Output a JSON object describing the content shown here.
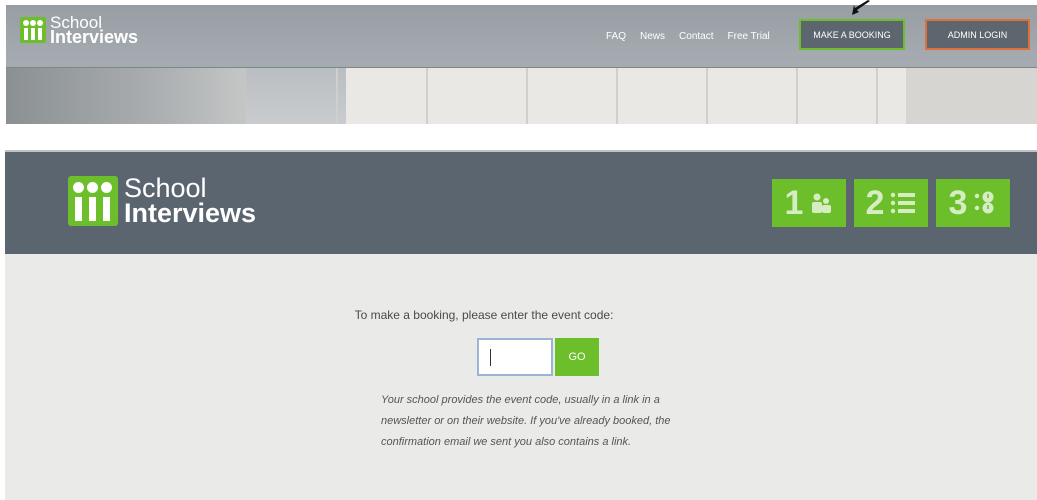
{
  "top_site": {
    "logo": {
      "line1": "School",
      "line2": "Interviews"
    },
    "nav": [
      {
        "label": "FAQ"
      },
      {
        "label": "News"
      },
      {
        "label": "Contact"
      },
      {
        "label": "Free Trial"
      }
    ],
    "make_booking_label": "MAKE A BOOKING",
    "admin_login_label": "ADMIN LOGIN",
    "colors": {
      "accent": "#6cbf2a",
      "admin_border": "#e0703a"
    }
  },
  "booking": {
    "logo": {
      "line1": "School",
      "line2": "Interviews"
    },
    "steps": [
      {
        "number": "1",
        "icon": "people-icon"
      },
      {
        "number": "2",
        "icon": "list-icon"
      },
      {
        "number": "3",
        "icon": "schedule-icon"
      }
    ],
    "prompt": "To make a booking, please enter the event code:",
    "code_input": {
      "value": "",
      "placeholder": ""
    },
    "go_label": "GO",
    "help_text": "Your school provides the event code, usually in a link in a newsletter or on their website. If you've already booked, the confirmation email we sent you also contains a link.",
    "colors": {
      "header": "#5b6570",
      "background": "#eaeae8",
      "accent": "#6cbf2a"
    }
  }
}
